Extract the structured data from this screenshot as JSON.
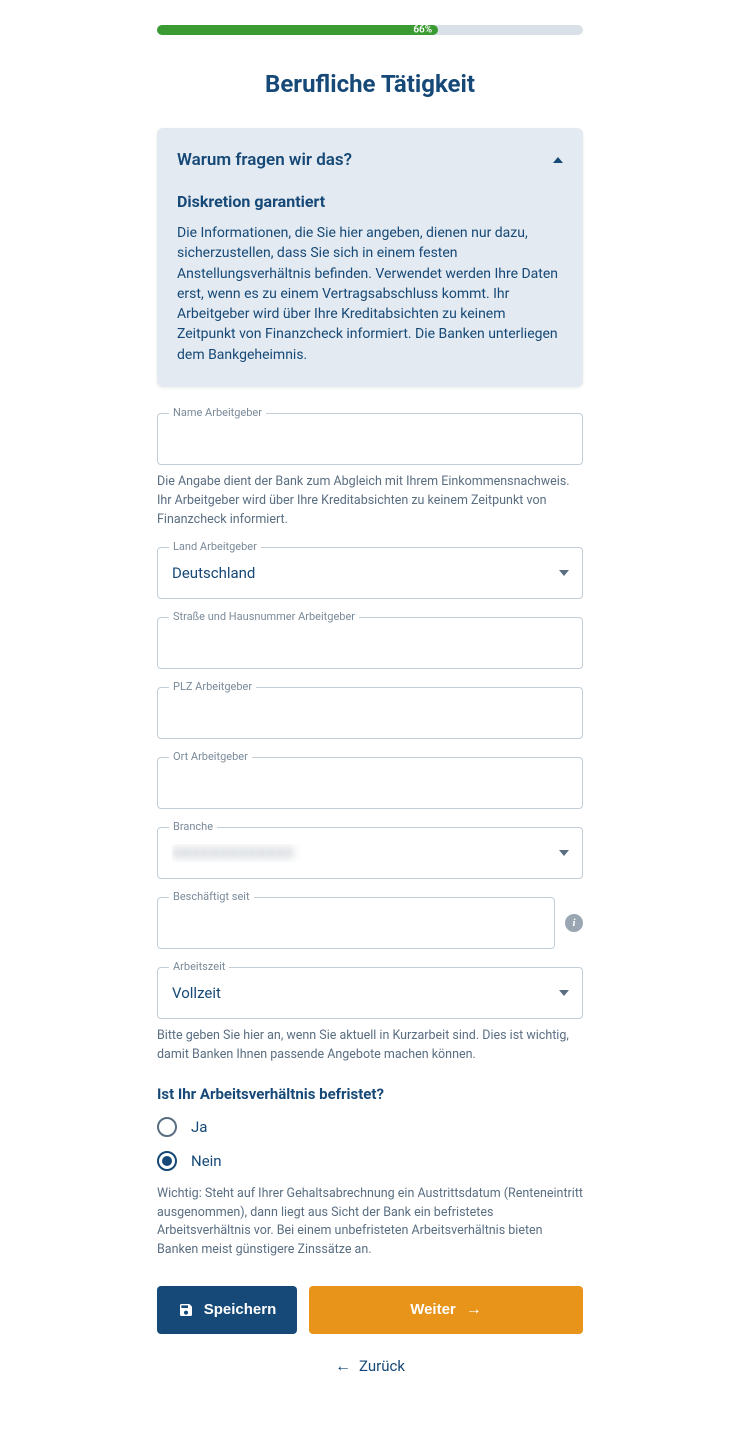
{
  "progress": {
    "percent": "66%",
    "width": "66%"
  },
  "page_title": "Berufliche Tätigkeit",
  "info_box": {
    "header": "Warum fragen wir das?",
    "subheader": "Diskretion garantiert",
    "body": "Die Informationen, die Sie hier angeben, dienen nur dazu, sicherzustellen, dass Sie sich in einem festen Anstellungsverhältnis befinden. Verwendet werden Ihre Daten erst, wenn es zu einem Vertragsabschluss kommt. Ihr Arbeitgeber wird über Ihre Kreditabsichten zu keinem Zeitpunkt von Finanzcheck informiert. Die Banken unterliegen dem Bankgeheimnis."
  },
  "fields": {
    "employer_name": {
      "label": "Name Arbeitgeber",
      "value": "",
      "help": "Die Angabe dient der Bank zum Abgleich mit Ihrem Einkommensnachweis. Ihr Arbeitgeber wird über Ihre Kreditabsichten zu keinem Zeitpunkt von Finanzcheck informiert."
    },
    "employer_country": {
      "label": "Land Arbeitgeber",
      "value": "Deutschland"
    },
    "employer_street": {
      "label": "Straße und Hausnummer Arbeitgeber",
      "value": ""
    },
    "employer_zip": {
      "label": "PLZ Arbeitgeber",
      "value": ""
    },
    "employer_city": {
      "label": "Ort Arbeitgeber",
      "value": ""
    },
    "branch": {
      "label": "Branche",
      "value": ""
    },
    "employed_since": {
      "label": "Beschäftigt seit",
      "value": ""
    },
    "work_time": {
      "label": "Arbeitszeit",
      "value": "Vollzeit",
      "help": "Bitte geben Sie hier an, wenn Sie aktuell in Kurzarbeit sind. Dies ist wichtig, damit Banken Ihnen passende Angebote machen können."
    }
  },
  "fixed_term": {
    "question": "Ist Ihr Arbeitsverhältnis befristet?",
    "options": {
      "yes": "Ja",
      "no": "Nein"
    },
    "selected": "no",
    "help": "Wichtig: Steht auf Ihrer Gehaltsabrechnung ein Austrittsdatum (Renteneintritt ausgenommen), dann liegt aus Sicht der Bank ein befristetes Arbeitsverhältnis vor. Bei einem unbefristeten Arbeitsverhältnis bieten Banken meist günstigere Zinssätze an."
  },
  "buttons": {
    "save": "Speichern",
    "next": "Weiter",
    "back": "Zurück"
  }
}
